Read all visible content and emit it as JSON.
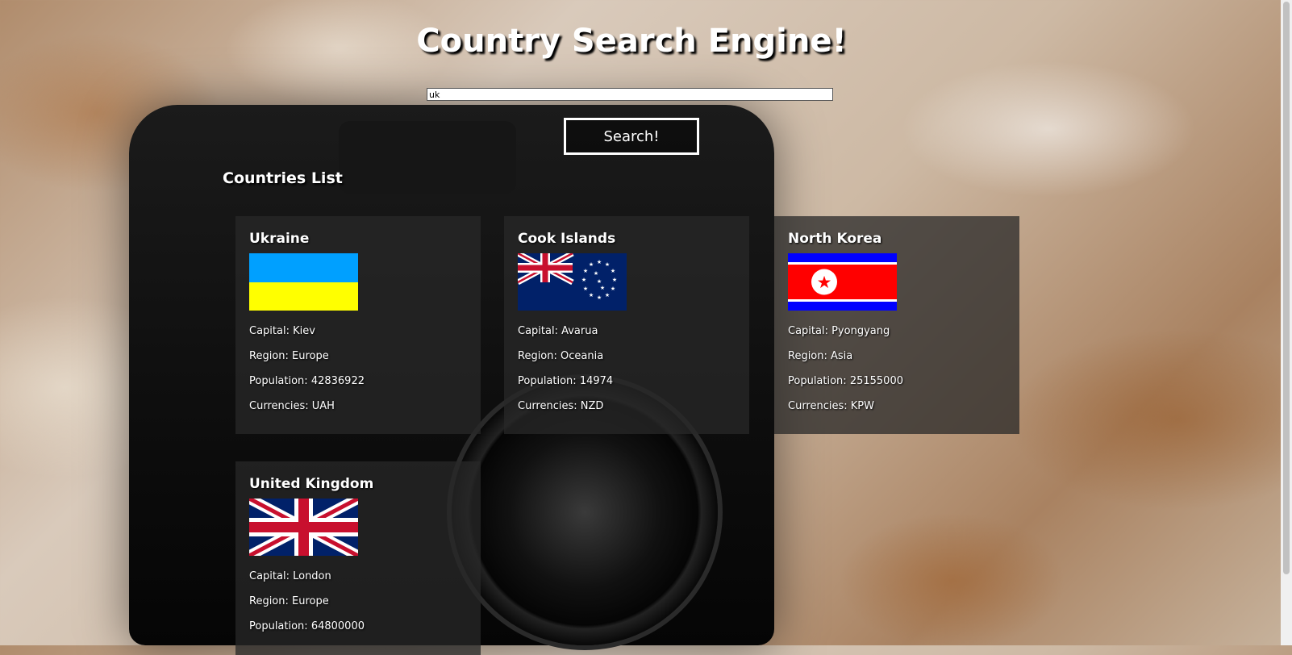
{
  "page": {
    "title": "Country Search Engine!"
  },
  "search": {
    "value": "uk",
    "button_label": "Search!"
  },
  "list": {
    "heading": "Countries List"
  },
  "labels": {
    "capital": "Capital",
    "region": "Region",
    "population": "Population",
    "currencies": "Currencies"
  },
  "countries": [
    {
      "name": "Ukraine",
      "flag_icon": "ukraine-flag-icon",
      "capital": "Capital: Kiev",
      "region": "Region: Europe",
      "population": "Population: 42836922",
      "currencies": "Currencies: UAH"
    },
    {
      "name": "Cook Islands",
      "flag_icon": "cook-islands-flag-icon",
      "capital": "Capital: Avarua",
      "region": "Region: Oceania",
      "population": "Population: 14974",
      "currencies": "Currencies: NZD"
    },
    {
      "name": "North Korea",
      "flag_icon": "north-korea-flag-icon",
      "capital": "Capital: Pyongyang",
      "region": "Region: Asia",
      "population": "Population: 25155000",
      "currencies": "Currencies: KPW"
    },
    {
      "name": "United Kingdom",
      "flag_icon": "united-kingdom-flag-icon",
      "capital": "Capital: London",
      "region": "Region: Europe",
      "population": "Population: 64800000",
      "currencies": ""
    }
  ],
  "colors": {
    "ukraine_blue": "#00a0ff",
    "ukraine_yellow": "#ffff00",
    "nk_red": "#ff0000",
    "nk_blue": "#0000ff",
    "uk_blue": "#012169",
    "uk_red": "#c8102e"
  }
}
